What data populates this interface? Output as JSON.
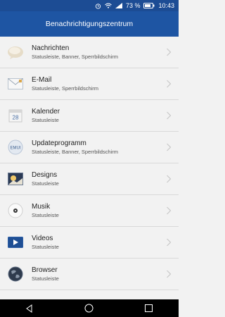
{
  "status": {
    "battery_percent": "73 %",
    "time": "10:43"
  },
  "header": {
    "title": "Benachrichtigungszentrum"
  },
  "calendar_day": "28",
  "emui_label": "EMUI",
  "apps": [
    {
      "name": "Nachrichten",
      "detail": "Statusleiste, Banner, Sperrbildschirm",
      "icon": "messages-icon"
    },
    {
      "name": "E-Mail",
      "detail": "Statusleiste, Sperrbildschirm",
      "icon": "email-icon"
    },
    {
      "name": "Kalender",
      "detail": "Statusleiste",
      "icon": "calendar-icon"
    },
    {
      "name": "Updateprogramm",
      "detail": "Statusleiste, Banner, Sperrbildschirm",
      "icon": "emui-update-icon"
    },
    {
      "name": "Designs",
      "detail": "Statusleiste",
      "icon": "themes-icon"
    },
    {
      "name": "Musik",
      "detail": "Statusleiste",
      "icon": "music-icon"
    },
    {
      "name": "Videos",
      "detail": "Statusleiste",
      "icon": "videos-icon"
    },
    {
      "name": "Browser",
      "detail": "Statusleiste",
      "icon": "browser-icon"
    }
  ],
  "colors": {
    "statusbar": "#1c4c94",
    "appbar": "#1e55a3",
    "background": "#f2f2f2",
    "navbar": "#000000"
  }
}
